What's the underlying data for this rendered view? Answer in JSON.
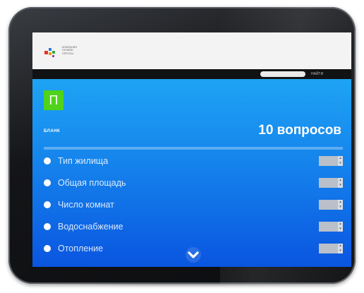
{
  "header": {
    "logo_lines": [
      "КОМПАНИЯ",
      "ОНЛАЙН",
      "ОПРОСЫ"
    ]
  },
  "navbar": {
    "search_placeholder": "",
    "search_button": "НАЙТИ"
  },
  "main": {
    "badge_letter": "П",
    "badge_caption": "БЛАНК",
    "questions_count": "10 вопросов",
    "questions": [
      {
        "label": "Тип жилища"
      },
      {
        "label": "Общая площадь"
      },
      {
        "label": "Число комнат"
      },
      {
        "label": "Водоснабжение"
      },
      {
        "label": "Отопление"
      }
    ]
  },
  "colors": {
    "accent_green": "#4fd31b",
    "screen_blue": "#1583ec",
    "header_bg": "#f3f3f3",
    "navbar_bg": "#111214"
  },
  "icons": {
    "scroll_down": "chevron-down-icon",
    "select_arrow": "updown-arrows-icon"
  }
}
